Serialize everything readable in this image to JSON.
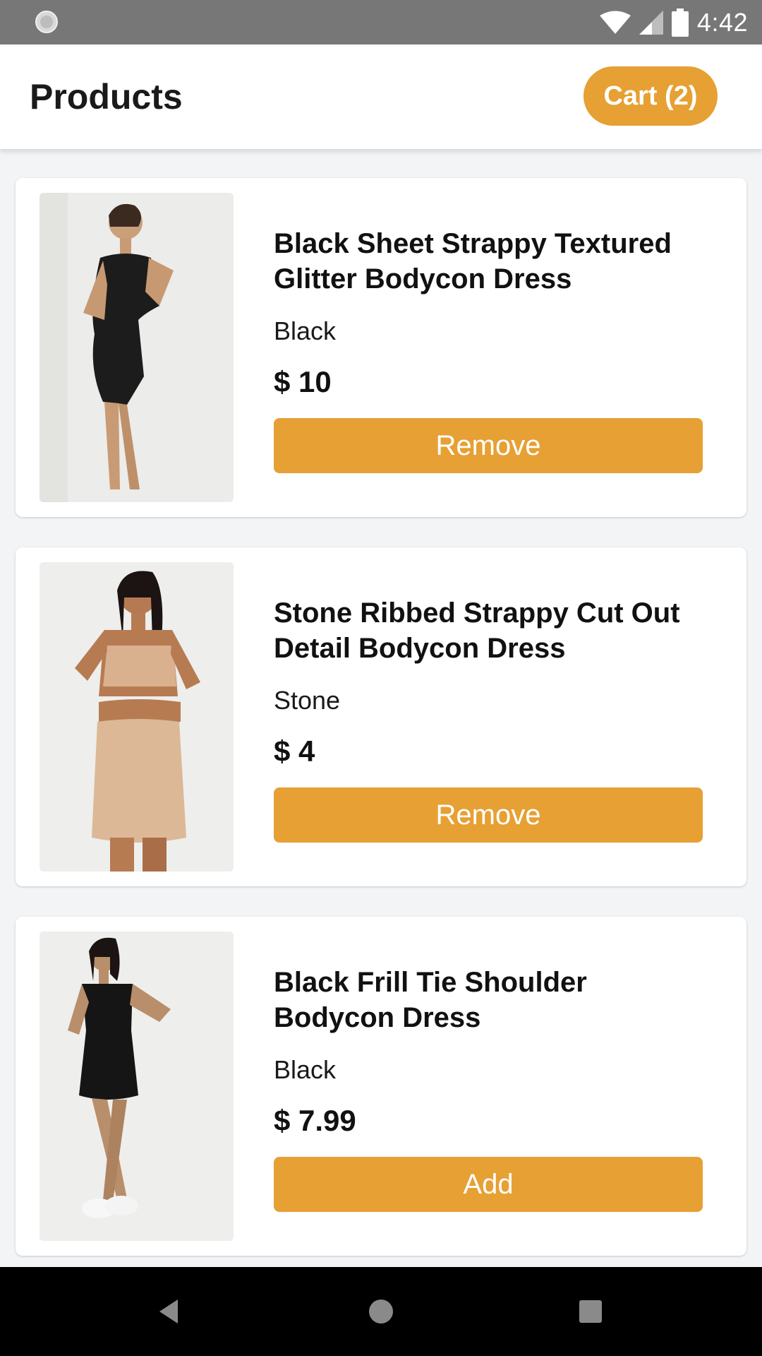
{
  "status_bar": {
    "time": "4:42",
    "icons": [
      "loading-icon",
      "wifi-icon",
      "signal-icon",
      "battery-icon"
    ]
  },
  "header": {
    "title": "Products",
    "cart_label": "Cart (2)"
  },
  "products": [
    {
      "title": "Black Sheet Strappy Textured Glitter Bodycon Dress",
      "color": "Black",
      "price": "$ 10",
      "button": "Remove"
    },
    {
      "title": "Stone Ribbed Strappy Cut Out Detail Bodycon Dress",
      "color": "Stone",
      "price": "$ 4",
      "button": "Remove"
    },
    {
      "title": "Black Frill Tie Shoulder Bodycon Dress",
      "color": "Black",
      "price": "$ 7.99",
      "button": "Add"
    }
  ],
  "nav_bar": {
    "icons": [
      "back-icon",
      "home-icon",
      "recent-apps-icon"
    ]
  },
  "colors": {
    "accent": "#e6a033",
    "status_bar": "#777777",
    "nav_bar": "#000000",
    "background": "#f3f4f6"
  }
}
